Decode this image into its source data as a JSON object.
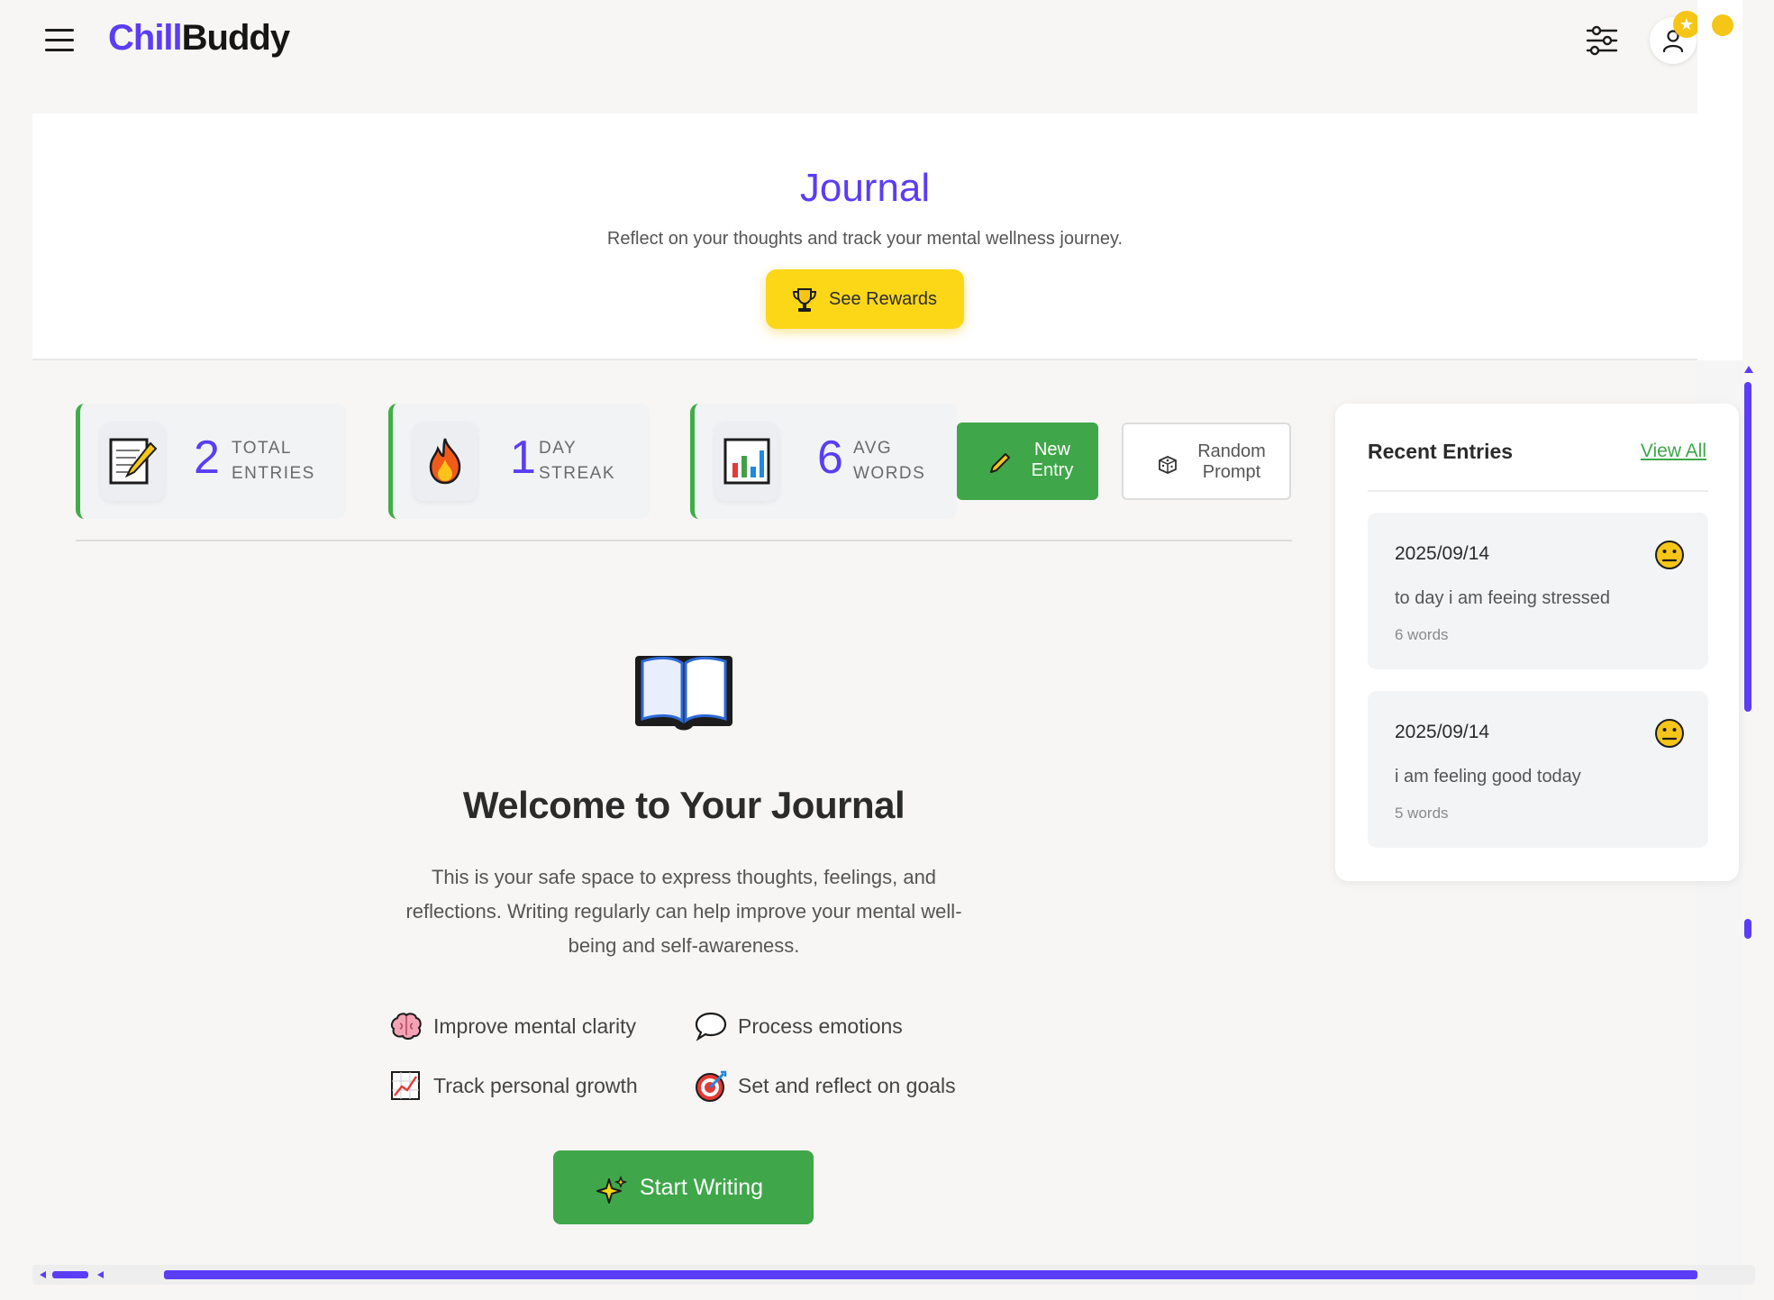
{
  "app": {
    "logo_part1": "Chill",
    "logo_part2": "Buddy",
    "brand_color": "#5b3df5",
    "accent_green": "#3fa64a",
    "accent_yellow": "#fcd718"
  },
  "header": {
    "menu_icon": "hamburger-icon",
    "filters_icon": "sliders-icon",
    "profile_icon": "user-icon",
    "badge_glyph": "★"
  },
  "hero": {
    "title": "Journal",
    "subtitle": "Reflect on your thoughts and track your mental wellness journey.",
    "rewards_label": "See Rewards"
  },
  "stats": [
    {
      "value": "2",
      "label_line1": "TOTAL",
      "label_line2": "ENTRIES",
      "icon": "memo-icon"
    },
    {
      "value": "1",
      "label_line1": "DAY",
      "label_line2": "STREAK",
      "icon": "fire-icon"
    },
    {
      "value": "6",
      "label_line1": "AVG",
      "label_line2": "WORDS",
      "icon": "bar-chart-icon"
    }
  ],
  "actions": {
    "new_entry_line1": "New",
    "new_entry_line2": "Entry",
    "random_prompt_line1": "Random",
    "random_prompt_line2": "Prompt"
  },
  "welcome": {
    "title": "Welcome to Your Journal",
    "text": "This is your safe space to express thoughts, feelings, and reflections. Writing regularly can help improve your mental well-being and self-awareness.",
    "benefits": [
      {
        "label": "Improve mental clarity",
        "icon": "brain-icon"
      },
      {
        "label": "Process emotions",
        "icon": "speech-bubble-icon"
      },
      {
        "label": "Track personal growth",
        "icon": "trending-chart-icon"
      },
      {
        "label": "Set and reflect on goals",
        "icon": "target-icon"
      }
    ],
    "start_label": "Start Writing"
  },
  "recent": {
    "title": "Recent Entries",
    "view_all": "View All",
    "entries": [
      {
        "date": "2025/09/14",
        "text": "to day i am feeing stressed",
        "words": "6 words",
        "mood_icon": "neutral-face-icon"
      },
      {
        "date": "2025/09/14",
        "text": "i am feeling good today",
        "words": "5 words",
        "mood_icon": "neutral-face-icon"
      }
    ]
  }
}
